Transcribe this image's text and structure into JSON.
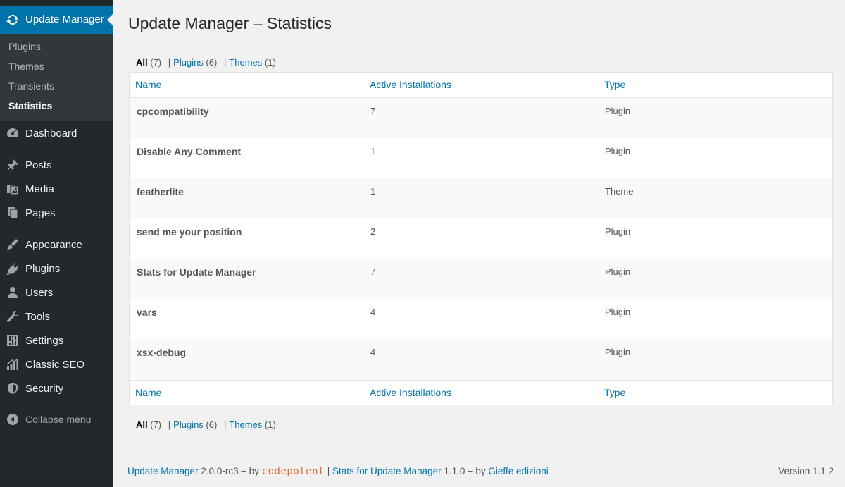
{
  "sidebar": {
    "current_menu": {
      "label": "Update Manager",
      "icon": "refresh-icon"
    },
    "submenu": [
      {
        "label": "Plugins"
      },
      {
        "label": "Themes"
      },
      {
        "label": "Transients"
      },
      {
        "label": "Statistics",
        "current": true
      }
    ],
    "items": [
      {
        "label": "Dashboard",
        "icon": "dashboard-icon"
      },
      {
        "label": "Posts",
        "icon": "pin-icon"
      },
      {
        "label": "Media",
        "icon": "media-icon"
      },
      {
        "label": "Pages",
        "icon": "pages-icon"
      },
      {
        "label": "Appearance",
        "icon": "brush-icon"
      },
      {
        "label": "Plugins",
        "icon": "plug-icon"
      },
      {
        "label": "Users",
        "icon": "user-icon"
      },
      {
        "label": "Tools",
        "icon": "wrench-icon"
      },
      {
        "label": "Settings",
        "icon": "sliders-icon"
      },
      {
        "label": "Classic SEO",
        "icon": "chart-icon"
      },
      {
        "label": "Security",
        "icon": "shield-icon"
      }
    ],
    "collapse_label": "Collapse menu"
  },
  "page": {
    "title": "Update Manager – Statistics"
  },
  "filters": {
    "all": {
      "label": "All",
      "count": "(7)"
    },
    "plugins": {
      "label": "Plugins",
      "count": "(6)"
    },
    "themes": {
      "label": "Themes",
      "count": "(1)"
    },
    "separator": "|"
  },
  "table": {
    "columns": [
      "Name",
      "Active Installations",
      "Type"
    ],
    "rows": [
      {
        "name": "cpcompatibility",
        "installations": "7",
        "type": "Plugin"
      },
      {
        "name": "Disable Any Comment",
        "installations": "1",
        "type": "Plugin"
      },
      {
        "name": "featherlite",
        "installations": "1",
        "type": "Theme"
      },
      {
        "name": "send me your position",
        "installations": "2",
        "type": "Plugin"
      },
      {
        "name": "Stats for Update Manager",
        "installations": "7",
        "type": "Plugin"
      },
      {
        "name": "vars",
        "installations": "4",
        "type": "Plugin"
      },
      {
        "name": "xsx-debug",
        "installations": "4",
        "type": "Plugin"
      }
    ]
  },
  "footer": {
    "um_link": "Update Manager",
    "um_version": "2.0.0-rc3 – by",
    "brand": "codepotent",
    "pipe": "|",
    "stats_link": "Stats for Update Manager",
    "stats_version": "1.1.0 – by",
    "author_link": "Gieffe edizioni",
    "version": "Version 1.1.2"
  },
  "colors": {
    "sidebar_bg": "#23282d",
    "submenu_bg": "#32373c",
    "accent": "#0073aa",
    "brand": "#e8692c",
    "page_bg": "#f1f1f1"
  }
}
